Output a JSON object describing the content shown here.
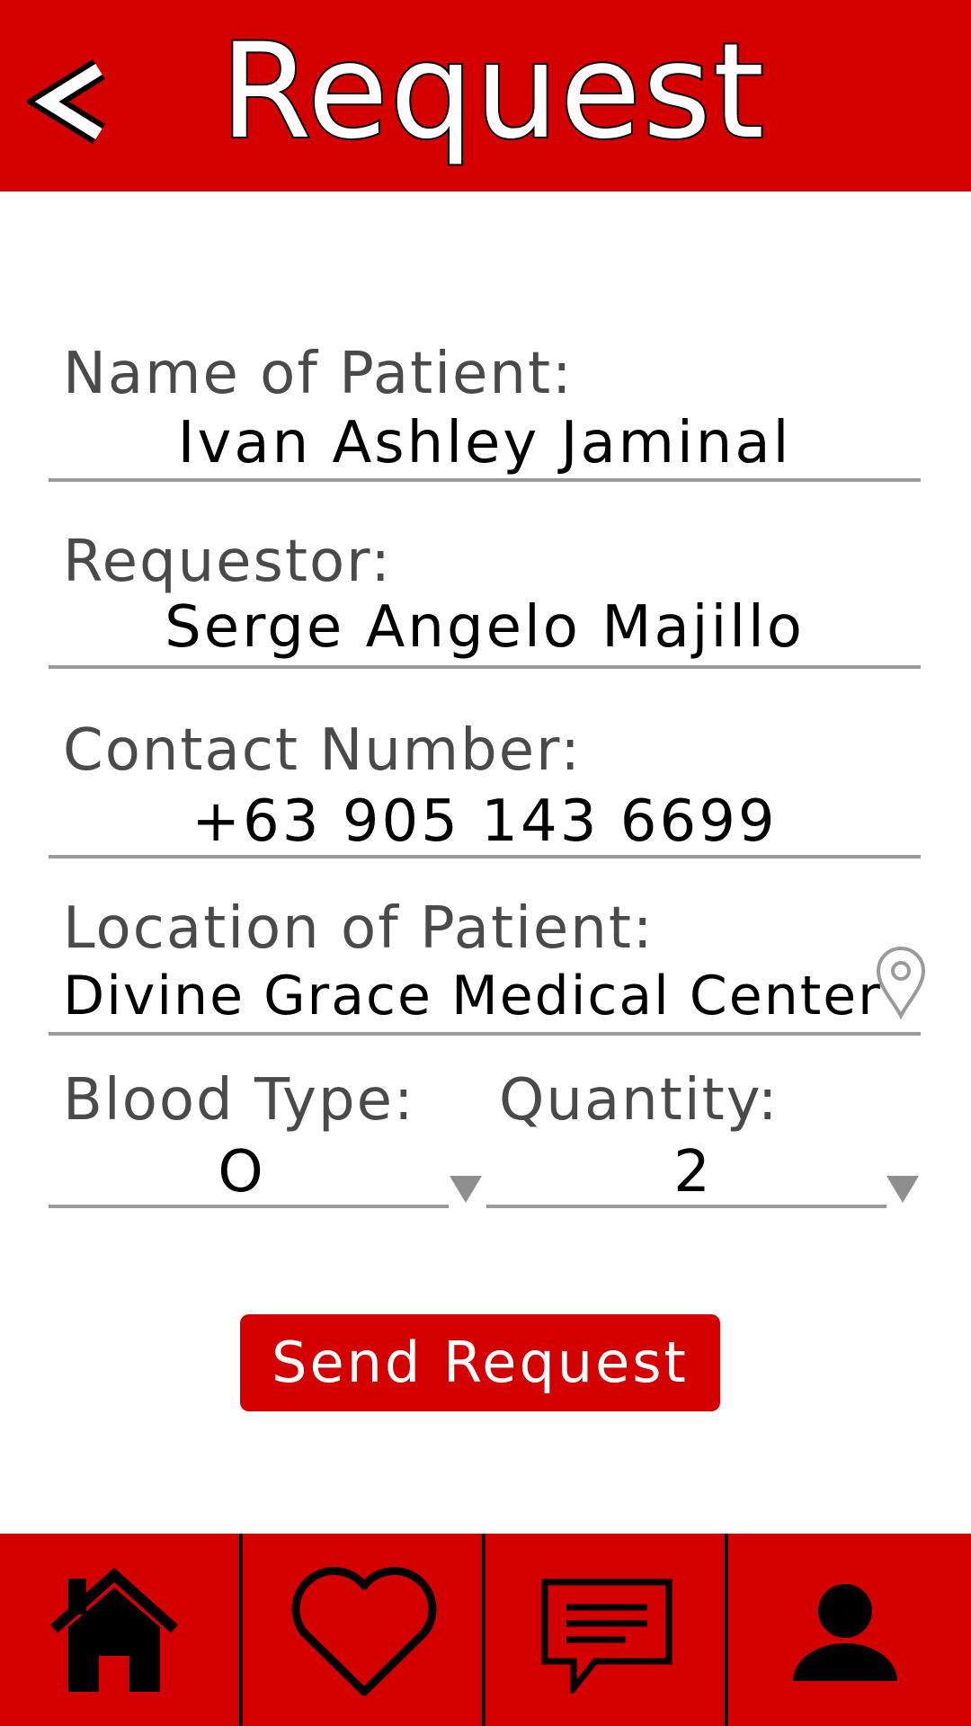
{
  "header": {
    "title": "Request",
    "back_icon": "chevron-left-icon"
  },
  "form": {
    "patient_name": {
      "label": "Name of Patient:",
      "value": "Ivan Ashley Jaminal"
    },
    "requestor": {
      "label": "Requestor:",
      "value": "Serge Angelo Majillo"
    },
    "contact_number": {
      "label": "Contact Number:",
      "value": "+63 905 143 6699"
    },
    "location": {
      "label": "Location of Patient:",
      "value": "Divine Grace Medical Center",
      "icon": "location-pin-icon"
    },
    "blood_type": {
      "label": "Blood Type:",
      "value": "O"
    },
    "quantity": {
      "label": "Quantity:",
      "value": "2"
    }
  },
  "send_button": {
    "label": "Send Request"
  },
  "bottom_nav": {
    "items": [
      {
        "icon": "home-icon"
      },
      {
        "icon": "heart-icon"
      },
      {
        "icon": "chat-icon"
      },
      {
        "icon": "profile-icon"
      }
    ]
  },
  "colors": {
    "brand_red": "#d40000",
    "label_gray": "#4a4a4a",
    "underline_gray": "#9a9a9a"
  }
}
